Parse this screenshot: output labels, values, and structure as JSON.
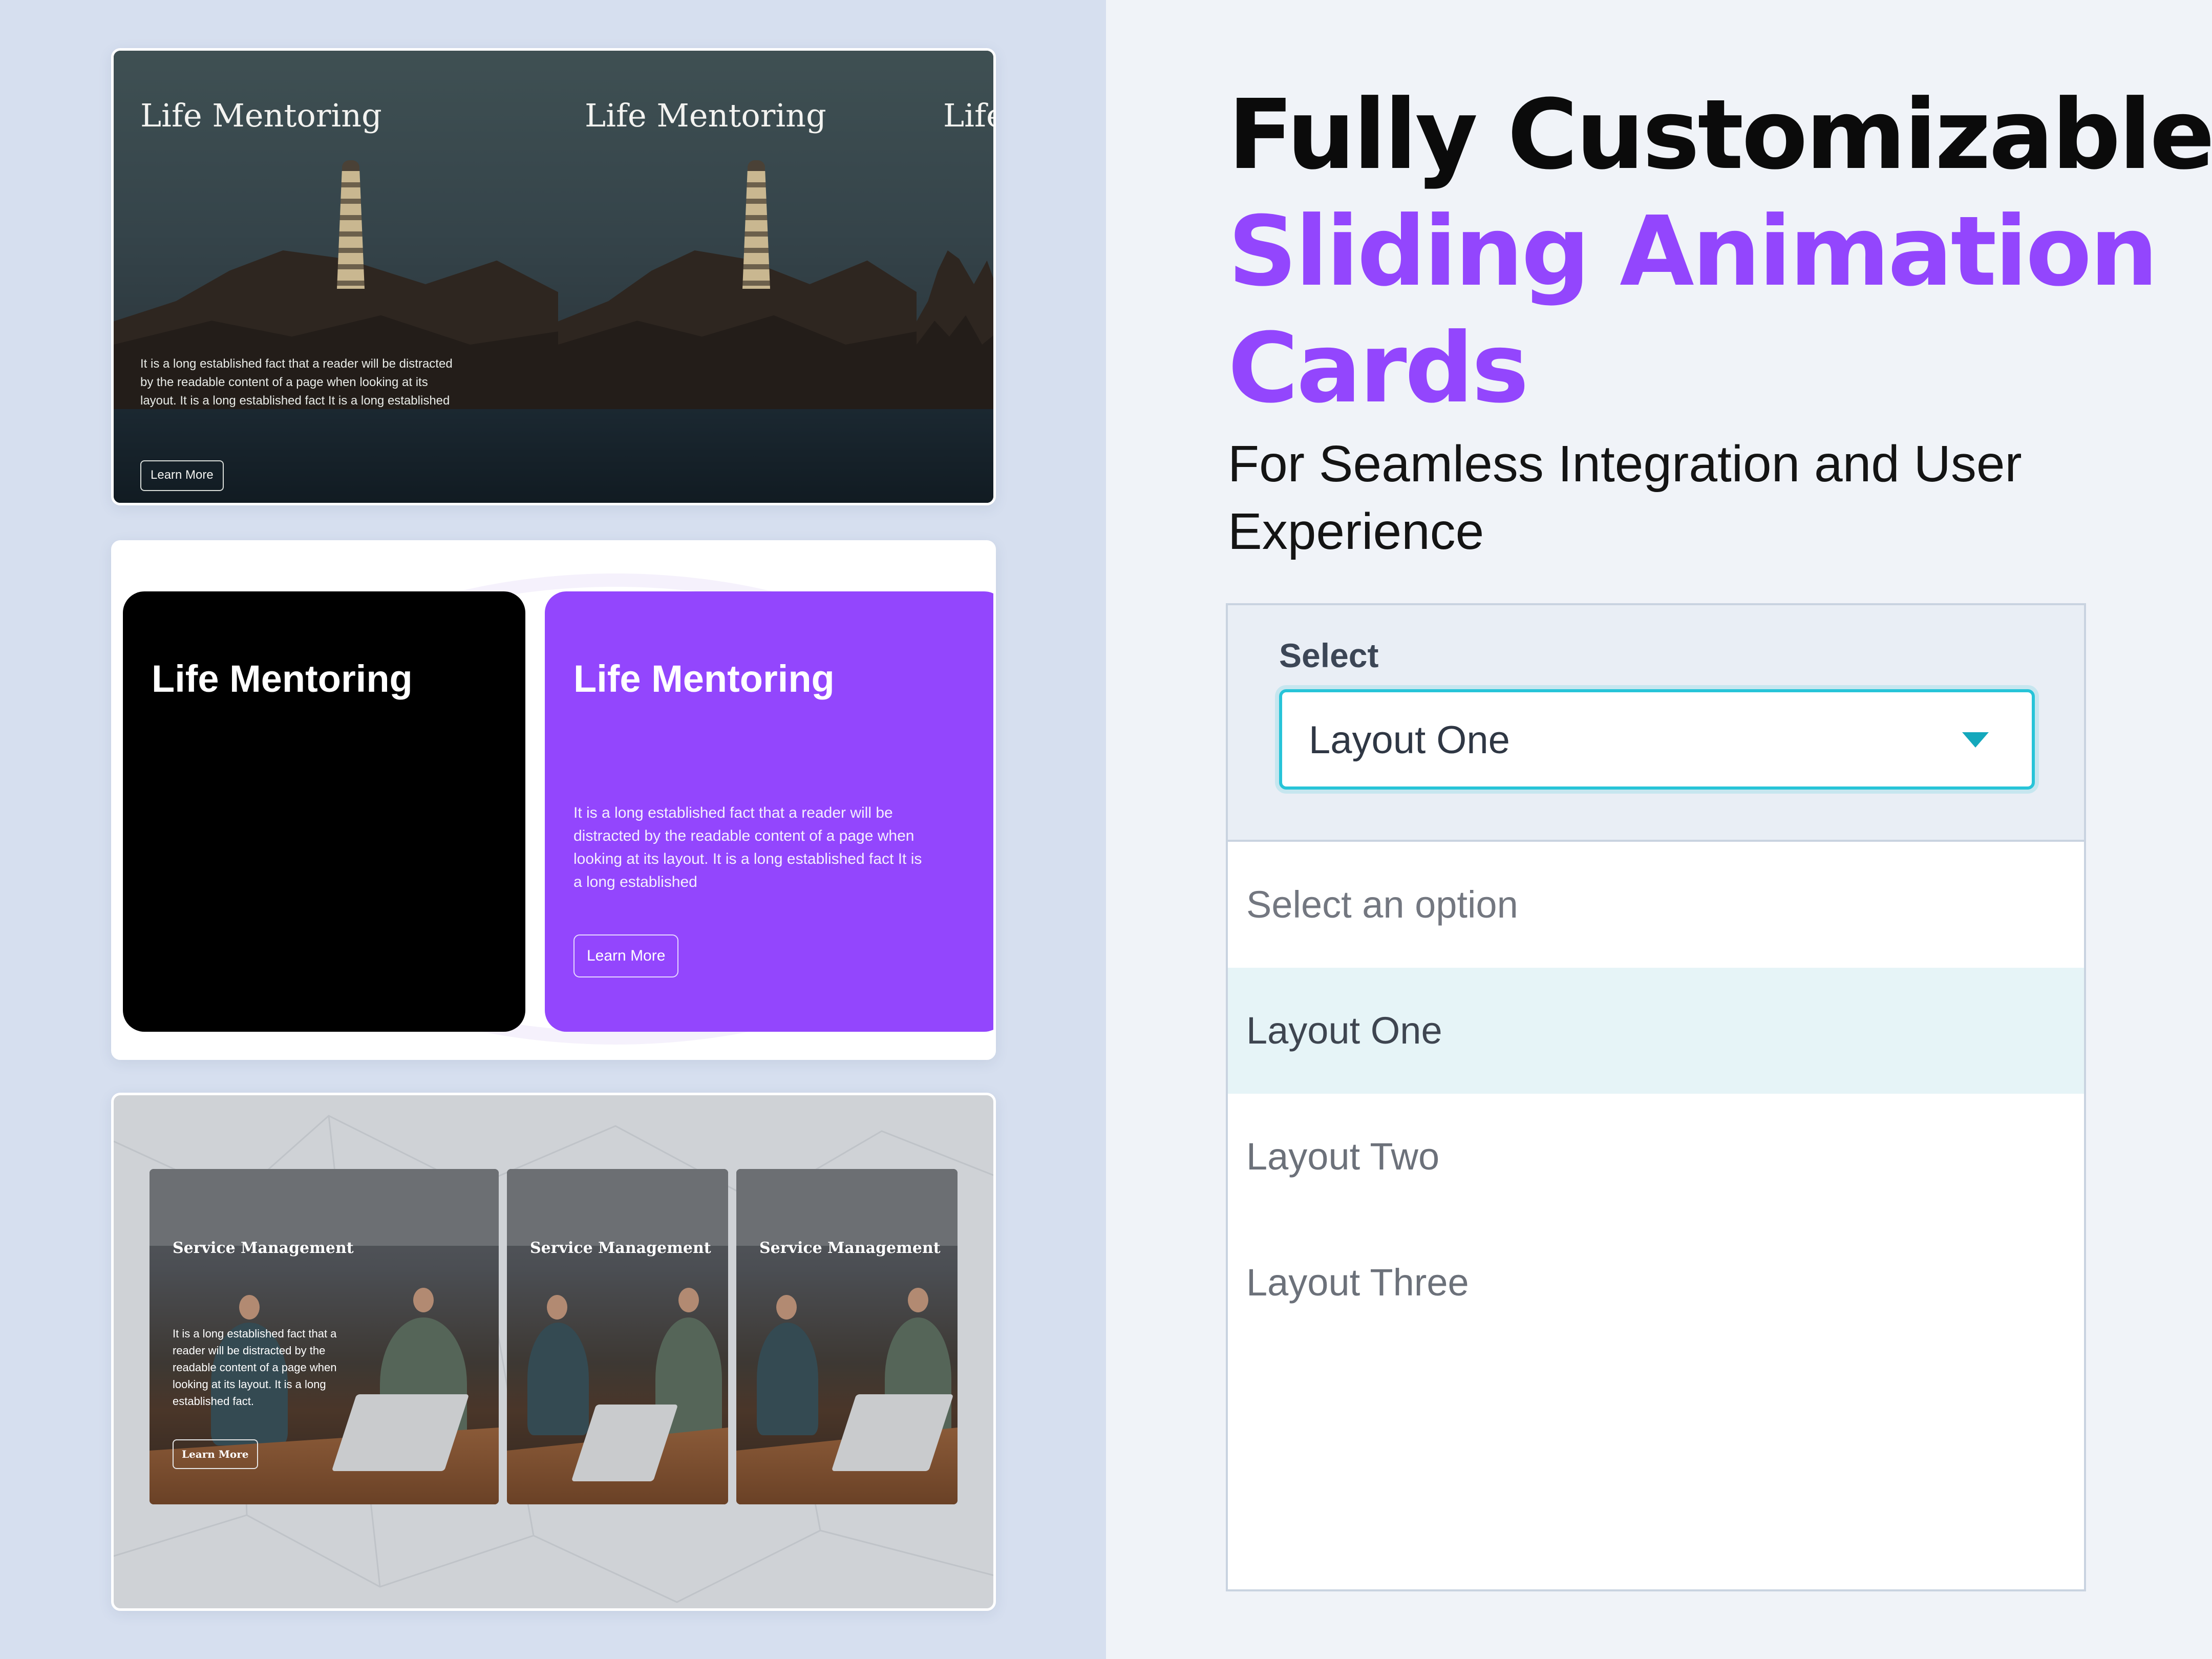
{
  "heading": {
    "line1": "Fully Customizable",
    "line2": "Sliding Animation",
    "line3": "Cards",
    "subtitle": "For Seamless Integration and User Experience"
  },
  "colors": {
    "accent": "#9346fd",
    "focus_ring": "#27c4d8",
    "selected_option_bg": "#e6f4f7"
  },
  "previews": {
    "layout_one": {
      "cards": [
        {
          "title": "Life Mentoring",
          "description": "It is a long established fact that a reader will be distracted by the readable content of a page when looking at its layout. It is a long established fact It is a long established",
          "button": "Learn More"
        },
        {
          "title": "Life Mentoring"
        },
        {
          "title": "Life"
        }
      ]
    },
    "layout_two": {
      "cards": [
        {
          "title": "Life Mentoring"
        },
        {
          "title": "Life Mentoring",
          "description": "It is a long established fact that a reader will be distracted by the readable content of a page when looking at its layout. It is a long established fact It is a long established",
          "button": "Learn More"
        }
      ]
    },
    "layout_three": {
      "cards": [
        {
          "title": "Service Management",
          "description": "It is a long established fact that a reader will be distracted by the readable content of a page when looking at its layout. It is a long established fact.",
          "button": "Learn More"
        },
        {
          "title": "Service Management"
        },
        {
          "title": "Service Management"
        }
      ]
    }
  },
  "select": {
    "label": "Select",
    "value": "Layout One",
    "icon": "chevron-down-icon",
    "options": [
      "Select an option",
      "Layout One",
      "Layout Two",
      "Layout Three"
    ]
  }
}
